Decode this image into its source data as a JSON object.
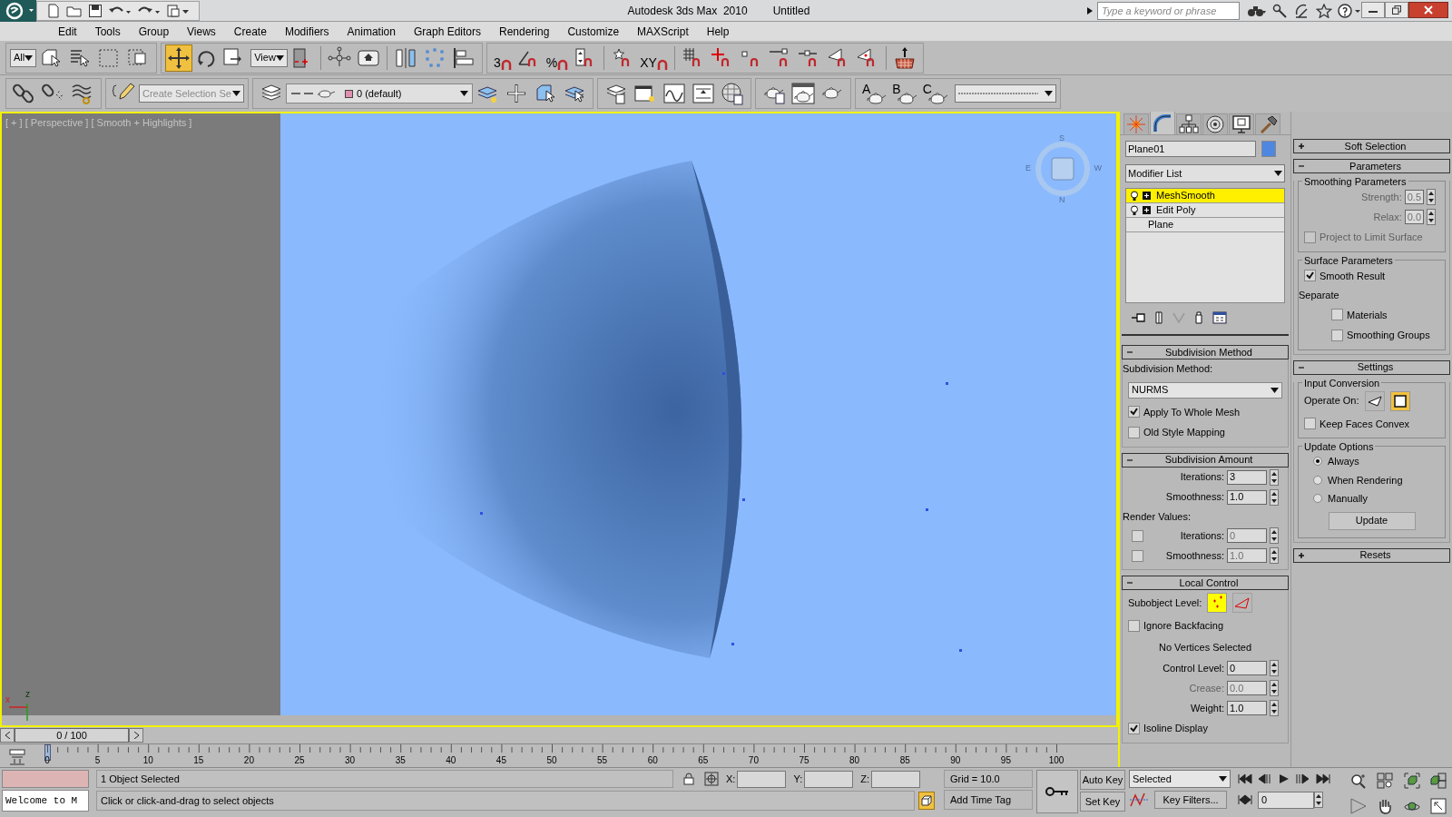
{
  "title_bar": {
    "product": "Autodesk 3ds Max  2010",
    "file": "Untitled",
    "search": {
      "placeholder": "Type a keyword or phrase"
    }
  },
  "menu": [
    "Edit",
    "Tools",
    "Group",
    "Views",
    "Create",
    "Modifiers",
    "Animation",
    "Graph Editors",
    "Rendering",
    "Customize",
    "MAXScript",
    "Help"
  ],
  "main_toolbar": {
    "selection_filter": "All",
    "reference_coordinate_system": "View",
    "transform_tools": [
      {
        "selected": true
      },
      {
        "selected": false
      },
      {
        "selected": false
      }
    ],
    "snap_labels": [
      "3",
      "%",
      "XY"
    ]
  },
  "second_toolbar": {
    "named_selection_set": {
      "placeholder": "Create Selection Se"
    },
    "layer": "0 (default)",
    "preset_labels": [
      "A",
      "B",
      "C"
    ]
  },
  "viewport": {
    "label": "[ + ] [ Perspective ] [ Smooth + Highlights ]",
    "compass": [
      "S",
      "W",
      "N",
      "E"
    ],
    "axes": [
      "x",
      "z"
    ]
  },
  "time_slider": {
    "reading": "0 / 100",
    "level": 0
  },
  "track_bar": {
    "ticks": [
      "0",
      "5",
      "10",
      "15",
      "20",
      "25",
      "30",
      "35",
      "40",
      "45",
      "50",
      "55",
      "60",
      "65",
      "70",
      "75",
      "80",
      "85",
      "90",
      "95",
      "100"
    ]
  },
  "command_panel": {
    "tabs": [
      {
        "selected": false
      },
      {
        "selected": true
      },
      {
        "selected": false
      },
      {
        "selected": false
      },
      {
        "selected": false
      },
      {
        "selected": false
      }
    ],
    "object_name": "Plane01",
    "modifier_list": "Modifier List",
    "stack": [
      {
        "label": "MeshSmooth",
        "selected": true,
        "kind": "modifier"
      },
      {
        "label": "Edit Poly",
        "selected": false,
        "kind": "modifier"
      },
      {
        "label": "Plane",
        "selected": false,
        "kind": "base"
      }
    ],
    "left_rollouts": [
      {
        "title": "Subdivision Method",
        "expanded": true,
        "items": [
          {
            "kind": "text",
            "label": "Subdivision Method:"
          },
          {
            "kind": "dropdown",
            "value": "NURMS"
          },
          {
            "kind": "checkbox",
            "label": "Apply To Whole Mesh",
            "checked": true,
            "disabled": false
          },
          {
            "kind": "checkbox",
            "label": "Old Style Mapping",
            "checked": false,
            "disabled": false
          }
        ]
      },
      {
        "title": "Subdivision Amount",
        "expanded": true,
        "items": [
          {
            "kind": "spinner",
            "label": "Iterations:",
            "value": "3",
            "disabled": false
          },
          {
            "kind": "spinner",
            "label": "Smoothness:",
            "value": "1.0",
            "disabled": false
          },
          {
            "kind": "text",
            "label": "Render Values:"
          },
          {
            "kind": "check_spinner",
            "label": "Iterations:",
            "value": "0",
            "checked": false,
            "disabled": true
          },
          {
            "kind": "check_spinner",
            "label": "Smoothness:",
            "value": "1.0",
            "checked": false,
            "disabled": true
          }
        ]
      },
      {
        "title": "Local Control",
        "expanded": true,
        "items": [
          {
            "kind": "icon_choice",
            "label": "Subobject Level:",
            "options": [
              {
                "selected": true
              },
              {
                "selected": false
              }
            ]
          },
          {
            "kind": "checkbox",
            "label": "Ignore Backfacing",
            "checked": false,
            "disabled": false
          },
          {
            "kind": "note",
            "label": "No Vertices Selected"
          },
          {
            "kind": "spinner",
            "label": "Control Level:",
            "value": "0",
            "disabled": false
          },
          {
            "kind": "spinner",
            "label": "Crease:",
            "value": "0.0",
            "disabled": true
          },
          {
            "kind": "spinner",
            "label": "Weight:",
            "value": "1.0",
            "disabled": false
          },
          {
            "kind": "checkbox",
            "label": "Isoline Display",
            "checked": true,
            "disabled": false
          }
        ]
      }
    ],
    "right_rollouts": [
      {
        "title": "Soft Selection",
        "expanded": false
      },
      {
        "title": "Parameters",
        "expanded": true,
        "items": [
          {
            "kind": "group",
            "title": "Smoothing Parameters",
            "items": [
              {
                "kind": "spinner",
                "label": "Strength:",
                "value": "0.5",
                "disabled": true
              },
              {
                "kind": "spinner",
                "label": "Relax:",
                "value": "0.0",
                "disabled": true
              },
              {
                "kind": "checkbox",
                "label": "Project to Limit Surface",
                "checked": false,
                "disabled": true
              }
            ]
          },
          {
            "kind": "group",
            "title": "Surface Parameters",
            "items": [
              {
                "kind": "checkbox",
                "label": "Smooth Result",
                "checked": true,
                "disabled": false
              },
              {
                "kind": "text",
                "label": "Separate"
              },
              {
                "kind": "subcheckbox",
                "label": "Materials",
                "checked": false,
                "disabled": false
              },
              {
                "kind": "subcheckbox",
                "label": "Smoothing Groups",
                "checked": false,
                "disabled": false
              }
            ]
          }
        ]
      },
      {
        "title": "Settings",
        "expanded": true,
        "items": [
          {
            "kind": "group",
            "title": "Input Conversion",
            "items": [
              {
                "kind": "icon_choice",
                "label": "Operate On:",
                "options": [
                  {
                    "selected": false
                  },
                  {
                    "selected": true
                  }
                ]
              },
              {
                "kind": "checkbox",
                "label": "Keep Faces Convex",
                "checked": false,
                "disabled": false
              }
            ]
          },
          {
            "kind": "group",
            "title": "Update Options",
            "items": [
              {
                "kind": "radio",
                "label": "Always",
                "selected": true
              },
              {
                "kind": "radio",
                "label": "When Rendering",
                "selected": false
              },
              {
                "kind": "radio",
                "label": "Manually",
                "selected": false
              },
              {
                "kind": "button",
                "label": "Update"
              }
            ]
          }
        ]
      },
      {
        "title": "Resets",
        "expanded": false
      }
    ]
  },
  "status": {
    "listener": "Welcome to M",
    "selection": "1 Object Selected",
    "prompt": "Click or click-and-drag to select objects",
    "coords": [
      "X:",
      "Y:",
      "Z:"
    ],
    "grid": "Grid = 10.0",
    "time_tag": "Add Time Tag",
    "auto_key": "Auto Key",
    "set_key": "Set Key",
    "key_mode": "Selected",
    "key_filters": "Key Filters...",
    "frame": "0"
  }
}
